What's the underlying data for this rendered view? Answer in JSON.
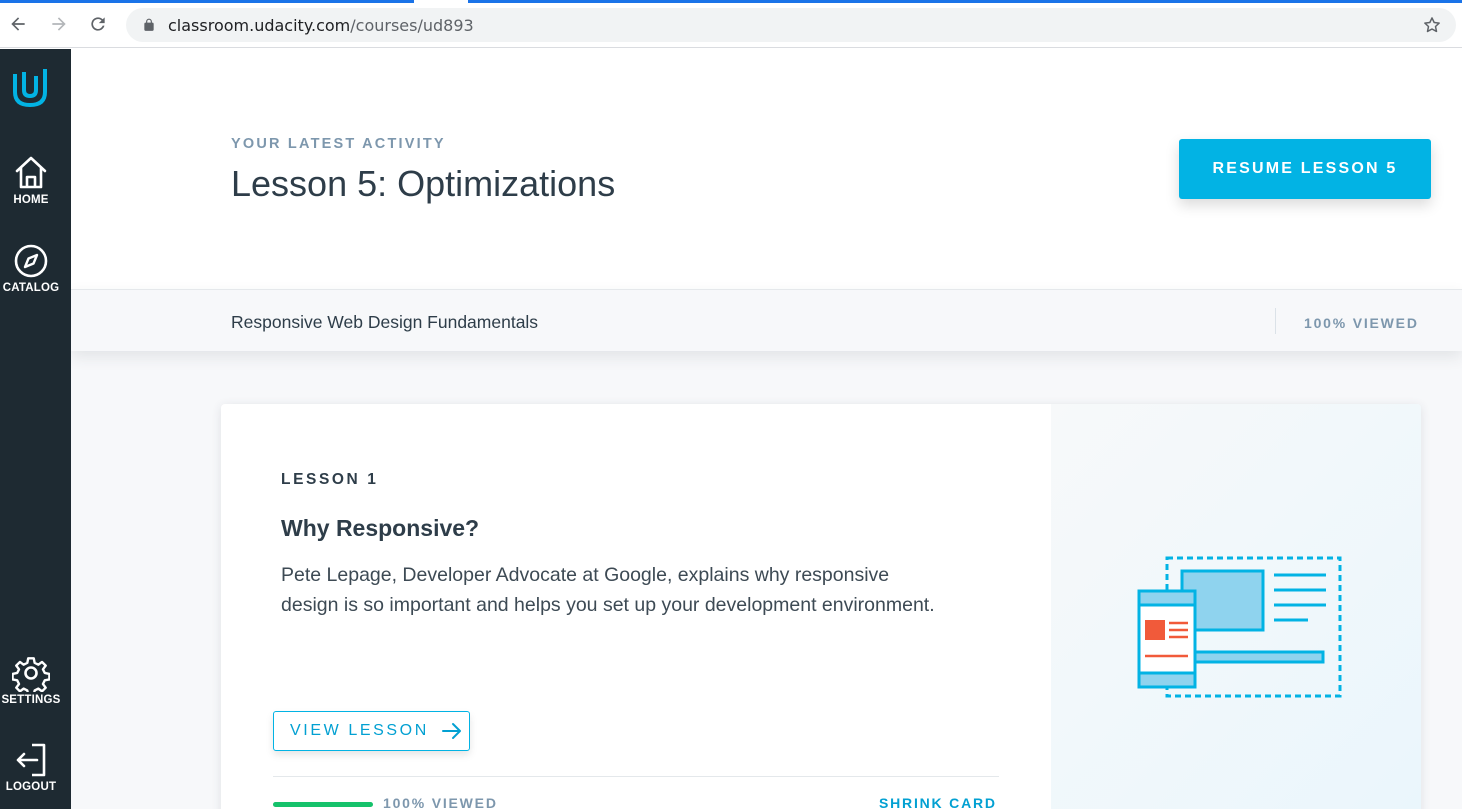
{
  "browser": {
    "url_host": "classroom.udacity.com",
    "url_path": "/courses/ud893"
  },
  "sidebar": {
    "items": [
      {
        "label": "HOME"
      },
      {
        "label": "CATALOG"
      },
      {
        "label": "SETTINGS"
      },
      {
        "label": "LOGOUT"
      }
    ]
  },
  "hero": {
    "eyebrow": "YOUR LATEST ACTIVITY",
    "title": "Lesson 5: Optimizations",
    "resume_label": "RESUME LESSON 5"
  },
  "course": {
    "name": "Responsive Web Design Fundamentals",
    "viewed": "100% VIEWED"
  },
  "lesson_card": {
    "number": "LESSON 1",
    "title": "Why Responsive?",
    "description": "Pete Lepage, Developer Advocate at Google, explains why responsive design is so important and helps you set up your development environment.",
    "view_label": "VIEW LESSON",
    "progress_fraction": 1.0,
    "progress_label": "100% VIEWED",
    "shrink_label": "SHRINK CARD"
  },
  "colors": {
    "accent": "#02b3e4",
    "sidebar_bg": "#1e2a32",
    "progress": "#15c26b",
    "illustration_red": "#f15a3a"
  }
}
